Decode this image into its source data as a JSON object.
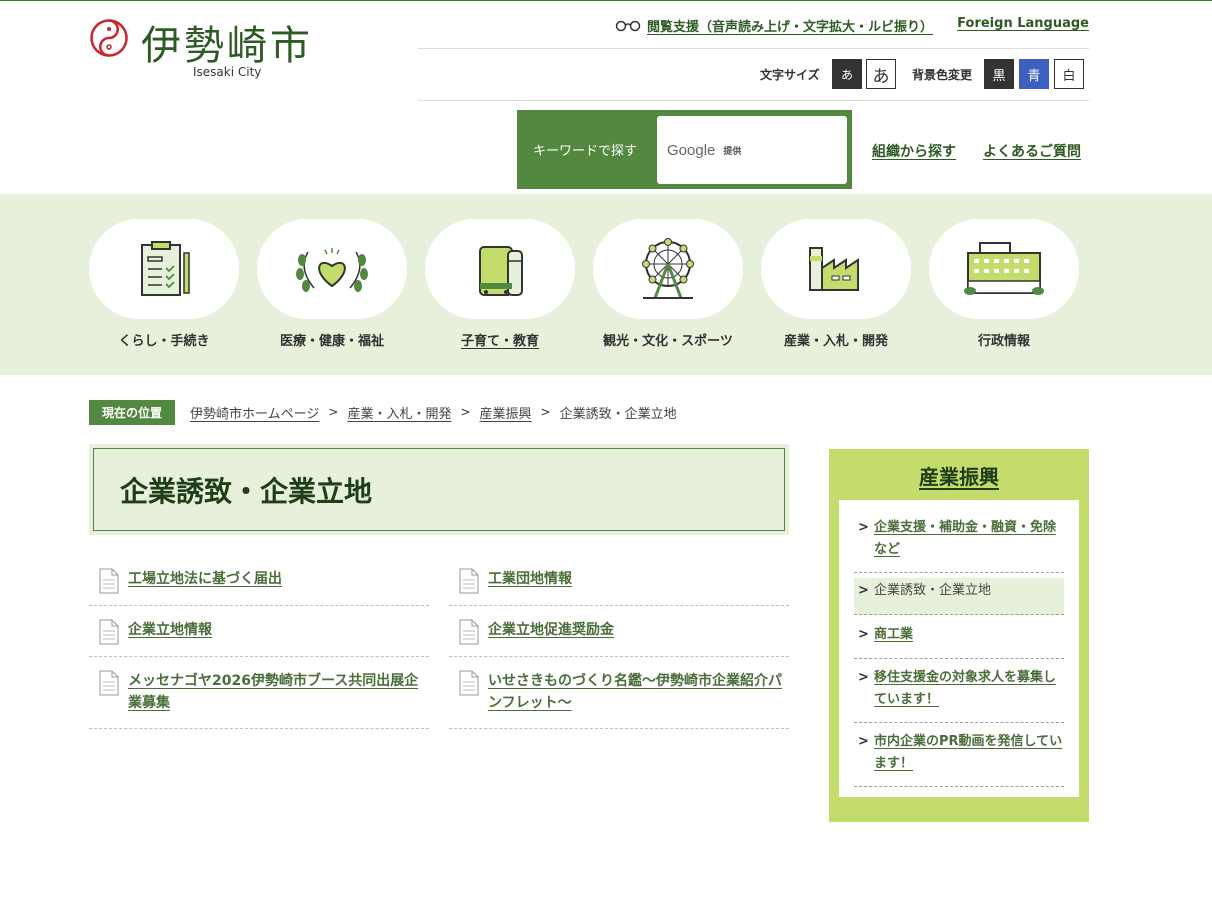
{
  "logo": {
    "name": "伊勢崎市",
    "sub": "Isesaki City"
  },
  "util": {
    "assist": "閲覧支援（音声読み上げ・文字拡大・ルビ振り）",
    "foreign": "Foreign Language",
    "font_size_label": "文字サイズ",
    "font_small": "あ",
    "font_large": "あ",
    "bg_label": "背景色変更",
    "bg_black": "黒",
    "bg_blue": "青",
    "bg_white": "白"
  },
  "search": {
    "label": "キーワードで探す",
    "google": "Google",
    "provided": "提供"
  },
  "toplinks": {
    "org": "組織から探す",
    "faq": "よくあるご質問"
  },
  "categories": [
    {
      "label": "くらし・手続き",
      "icon": "clipboard-icon"
    },
    {
      "label": "医療・健康・福祉",
      "icon": "heart-wreath-icon"
    },
    {
      "label": "子育て・教育",
      "icon": "school-bag-icon"
    },
    {
      "label": "観光・文化・スポーツ",
      "icon": "ferris-wheel-icon"
    },
    {
      "label": "産業・入札・開発",
      "icon": "factory-icon"
    },
    {
      "label": "行政情報",
      "icon": "city-hall-icon"
    }
  ],
  "breadcrumb": {
    "here": "現在の位置",
    "items": [
      "伊勢崎市ホームページ",
      "産業・入札・開発",
      "産業振興",
      "企業誘致・企業立地"
    ]
  },
  "page_title": "企業誘致・企業立地",
  "links": [
    "工場立地法に基づく届出",
    "工業団地情報",
    "企業立地情報",
    "企業立地促進奨励金",
    "メッセナゴヤ2026伊勢崎市ブース共同出展企業募集",
    "いせさきものづくり名鑑～伊勢崎市企業紹介パンフレット～"
  ],
  "side": {
    "title": "産業振興",
    "items": [
      "企業支援・補助金・融資・免除など",
      "企業誘致・企業立地",
      "商工業",
      "移住支援金の対象求人を募集しています！",
      "市内企業のPR動画を発信しています！"
    ]
  },
  "colors": {
    "brand_green": "#52883f",
    "light_green": "#e7f0da",
    "side_green": "#c4dc6c",
    "logo_red": "#c8262d"
  }
}
